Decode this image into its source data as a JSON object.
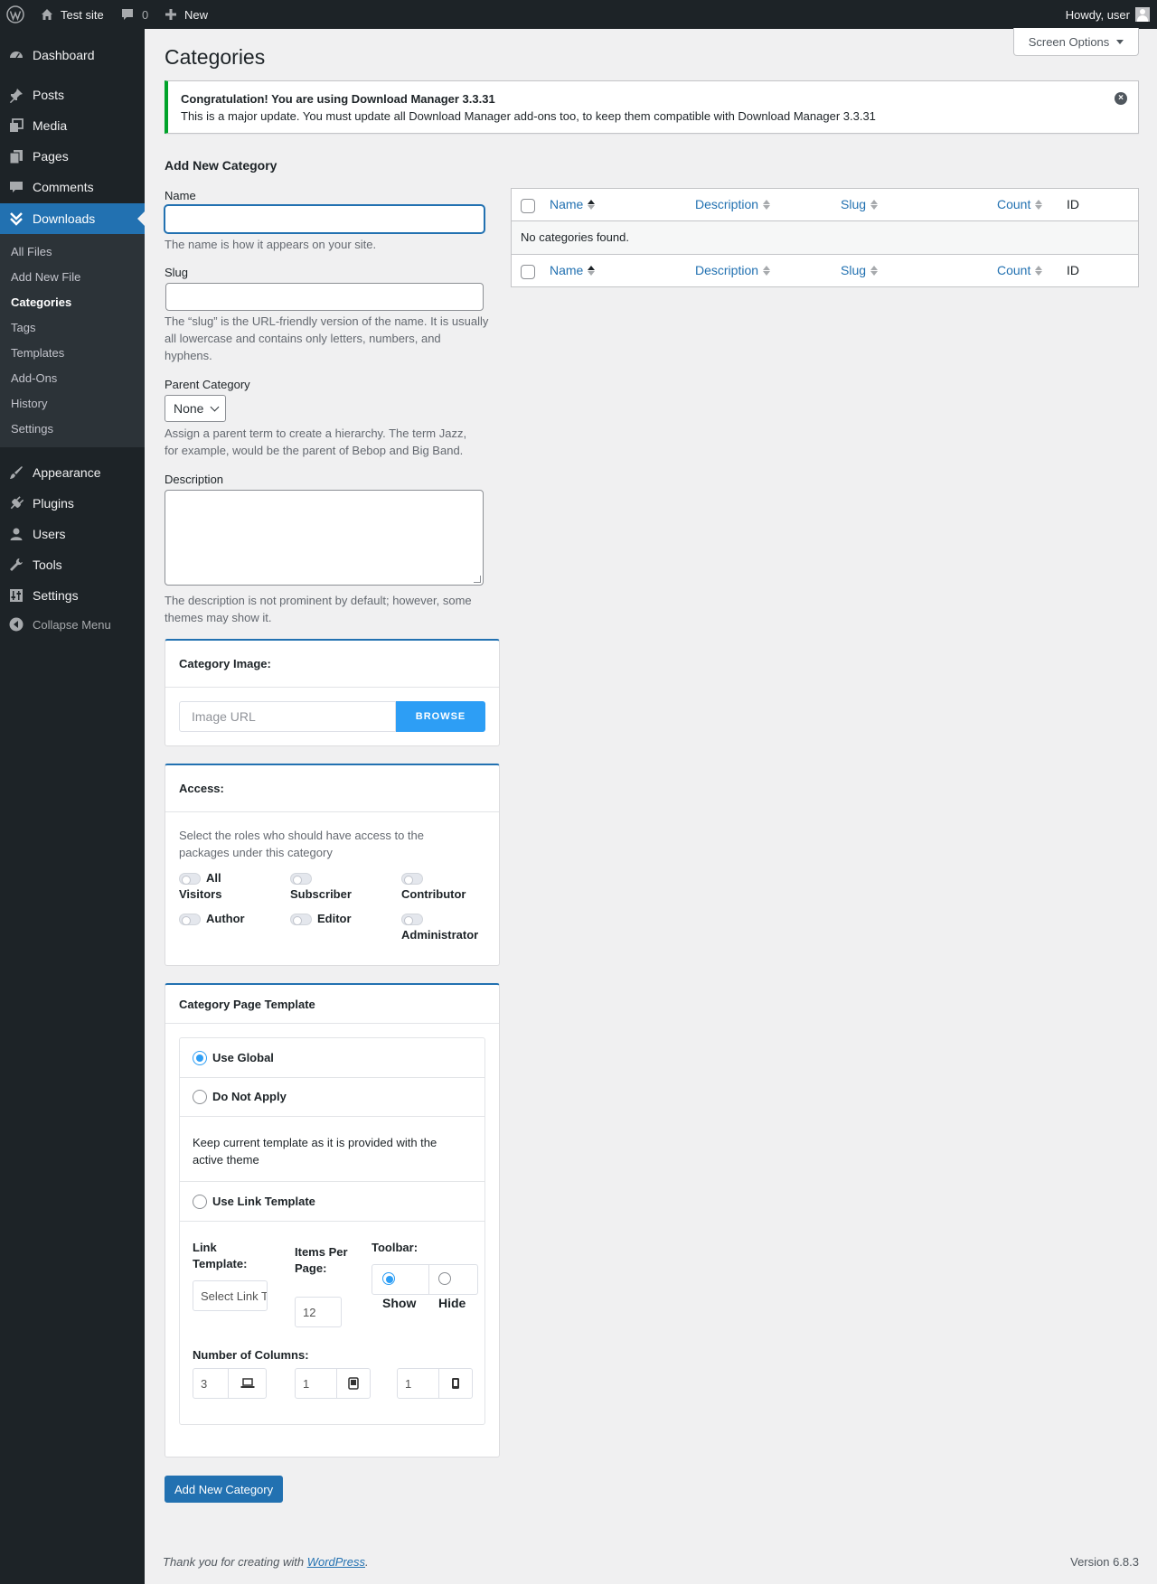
{
  "adminbar": {
    "site_name": "Test site",
    "comments_count": "0",
    "new_label": "New",
    "howdy": "Howdy, user"
  },
  "sidebar": {
    "items": [
      {
        "label": "Dashboard",
        "icon": "dashboard-icon"
      },
      {
        "label": "Posts",
        "icon": "pin-icon"
      },
      {
        "label": "Media",
        "icon": "media-icon"
      },
      {
        "label": "Pages",
        "icon": "pages-icon"
      },
      {
        "label": "Comments",
        "icon": "comment-icon"
      },
      {
        "label": "Downloads",
        "icon": "downloads-icon",
        "active": true
      },
      {
        "label": "Appearance",
        "icon": "brush-icon"
      },
      {
        "label": "Plugins",
        "icon": "plugin-icon"
      },
      {
        "label": "Users",
        "icon": "user-icon"
      },
      {
        "label": "Tools",
        "icon": "wrench-icon"
      },
      {
        "label": "Settings",
        "icon": "settings-icon"
      }
    ],
    "submenu": [
      "All Files",
      "Add New File",
      "Categories",
      "Tags",
      "Templates",
      "Add-Ons",
      "History",
      "Settings"
    ],
    "current_submenu": "Categories",
    "collapse_label": "Collapse Menu"
  },
  "header": {
    "title": "Categories",
    "screen_options": "Screen Options"
  },
  "notice": {
    "title": "Congratulation! You are using Download Manager 3.3.31",
    "message": "This is a major update. You must update all Download Manager add-ons too, to keep them compatible with Download Manager 3.3.31"
  },
  "form": {
    "heading": "Add New Category",
    "name_label": "Name",
    "name_help": "The name is how it appears on your site.",
    "slug_label": "Slug",
    "slug_help": "The “slug” is the URL-friendly version of the name. It is usually all lowercase and contains only letters, numbers, and hyphens.",
    "parent_label": "Parent Category",
    "parent_value": "None",
    "parent_help": "Assign a parent term to create a hierarchy. The term Jazz, for example, would be the parent of Bebop and Big Band.",
    "description_label": "Description",
    "description_help": "The description is not prominent by default; however, some themes may show it.",
    "submit": "Add New Category"
  },
  "image_panel": {
    "title": "Category Image:",
    "placeholder": "Image URL",
    "browse": "BROWSE"
  },
  "access_panel": {
    "title": "Access:",
    "description": "Select the roles who should have access to the packages under this category",
    "roles": [
      "All Visitors",
      "Subscriber",
      "Contributor",
      "Author",
      "Editor",
      "Administrator"
    ]
  },
  "template_panel": {
    "title": "Category Page Template",
    "use_global": "Use Global",
    "do_not_apply": "Do Not Apply",
    "do_not_apply_help": "Keep current template as it is provided with the active theme",
    "use_link": "Use Link Template",
    "link_template_label": "Link Template:",
    "link_template_value": "Select Link Template",
    "items_per_page_label": "Items Per Page:",
    "items_per_page_value": "12",
    "toolbar_label": "Toolbar:",
    "toolbar_show": "Show",
    "toolbar_hide": "Hide",
    "columns_label": "Number of Columns:",
    "col_desktop": "3",
    "col_tablet": "1",
    "col_mobile": "1"
  },
  "table": {
    "columns": [
      "Name",
      "Description",
      "Slug",
      "Count",
      "ID"
    ],
    "empty": "No categories found."
  },
  "footer": {
    "thanks_prefix": "Thank you for creating with ",
    "thanks_link": "WordPress",
    "thanks_suffix": ".",
    "version": "Version 6.8.3"
  }
}
